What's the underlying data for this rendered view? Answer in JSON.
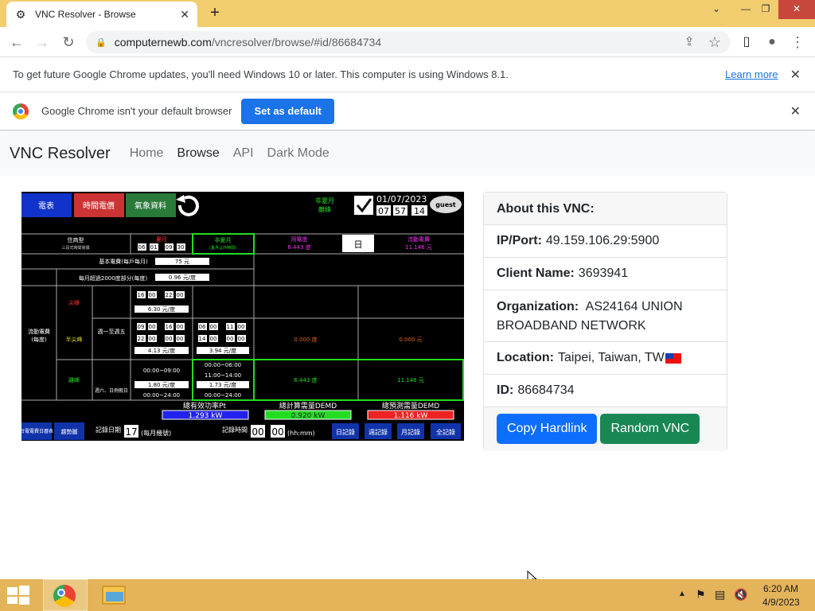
{
  "tab": {
    "title": "VNC Resolver - Browse",
    "close": "✕"
  },
  "newtab": "+",
  "window_controls": [
    "⌄",
    "—",
    "❐",
    "✕"
  ],
  "nav_buttons": {
    "back": "←",
    "forward": "→",
    "reload": "↻"
  },
  "address": {
    "host": "computernewb.com",
    "path": "/vncresolver/browse/#id/86684734"
  },
  "toolbar_icons": {
    "share": "⇪",
    "star": "☆",
    "sidepanel": "▯",
    "profile": "●",
    "menu": "⋮"
  },
  "infobar_update": {
    "text": "To get future Google Chrome updates, you'll need Windows 10 or later. This computer is using Windows 8.1.",
    "link": "Learn more",
    "close": "✕"
  },
  "infobar_default": {
    "text": "Google Chrome isn't your default browser",
    "button": "Set as default",
    "close": "✕"
  },
  "site": {
    "brand": "VNC Resolver",
    "nav": [
      "Home",
      "Browse",
      "API",
      "Dark Mode"
    ],
    "active": "Browse"
  },
  "vnc_screen": {
    "buttons": [
      "電表",
      "時間電價",
      "氣象資料"
    ],
    "season": "非夏月",
    "season_sub": "離峰",
    "date": "01/07/2023",
    "time": [
      "07",
      "57",
      "14"
    ],
    "user": "guest",
    "row1": {
      "type": "住商型",
      "type_sub": "三段式時間電價",
      "summer": "夏月",
      "summer_range": [
        "06",
        "01",
        "09",
        "30"
      ],
      "nonsummer": "非夏月",
      "nonsummer_sub": "(夏月以外時間)",
      "usage_label": "用電度",
      "usage_value": "6.443 度",
      "day": "日",
      "fee_label": "流動電費",
      "fee_value": "11.146 元"
    },
    "base_fee": {
      "label": "基本電費(每戶每月)",
      "value": "75 元"
    },
    "over2000": {
      "label": "每月超過2000度部分(每度)",
      "value": "0.96 元/度"
    },
    "flow": {
      "label": "流動電費",
      "label_sub": "(每度)"
    },
    "peak": {
      "label": "尖峰",
      "t1": [
        "16",
        "00",
        "22",
        "00"
      ],
      "price": "6.30 元/度"
    },
    "weekday": "週一至週五",
    "half": {
      "label": "半尖峰",
      "t1": [
        "09",
        "00",
        "16",
        "00"
      ],
      "t2": [
        "22",
        "00",
        "00",
        "00"
      ],
      "price": "4.13 元/度",
      "ns_t1": [
        "06",
        "00",
        "11",
        "00"
      ],
      "ns_t2": [
        "14",
        "00",
        "00",
        "00"
      ],
      "ns_price": "3.94 元/度",
      "usage": "0.000 度",
      "fee": "0.000 元"
    },
    "off": {
      "label": "離峰",
      "weekend": "週六、日例假日",
      "t1": "00:00~09:00",
      "price": "1.80 元/度",
      "t2": "00:00~24:00",
      "ns_t1": "00:00~06:00",
      "ns_t2": "11:00~14:00",
      "ns_price": "1.73 元/度",
      "ns_t3": "00:00~24:00",
      "usage": "6.443 度",
      "fee": "11.146 元"
    },
    "meters": [
      {
        "label": "總有效功率Pt",
        "value": "1.293 kW",
        "color": "#2222ee"
      },
      {
        "label": "總計算需量DEMD",
        "value": "0.920 kW",
        "color": "#22dd22"
      },
      {
        "label": "總預測需量DEMD",
        "value": "1.116 kW",
        "color": "#ee2222"
      }
    ],
    "bottom_buttons": [
      "台電電費日曆表",
      "趨勢圖"
    ],
    "record_day_label": "記錄日期",
    "record_day": "17",
    "record_day_hint": "(每月幾號)",
    "record_time_label": "記錄時間",
    "record_time": [
      "00",
      "00"
    ],
    "record_time_hint": "(hh:mm)",
    "log_buttons": [
      "日記錄",
      "週記錄",
      "月記錄",
      "全記錄"
    ]
  },
  "about": {
    "header": "About this VNC:",
    "ipport_label": "IP/Port:",
    "ipport": "49.159.106.29:5900",
    "client_label": "Client Name:",
    "client": "3693941",
    "org_label": "Organization:",
    "org": "AS24164 UNION BROADBAND NETWORK",
    "location_label": "Location:",
    "location": "Taipei, Taiwan, TW",
    "id_label": "ID:",
    "id": "86684734",
    "copy_button": "Copy Hardlink",
    "random_button": "Random VNC"
  },
  "taskbar": {
    "time": "6:20 AM",
    "date": "4/9/2023"
  },
  "colors": {
    "primary": "#0d6efd",
    "success": "#198754",
    "chrome_blue": "#1a73e8",
    "tab_bar": "#f2cd70",
    "taskbar": "#e3b45a"
  }
}
